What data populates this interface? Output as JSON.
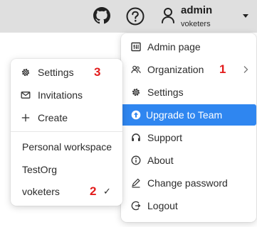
{
  "header": {
    "username": "admin",
    "login": "voketers",
    "icons": [
      "github-icon",
      "help-icon",
      "user-icon",
      "caret-down-icon"
    ]
  },
  "user_menu": {
    "items": [
      {
        "label": "Admin page",
        "icon": "admin-panel-icon"
      },
      {
        "label": "Organization",
        "icon": "organization-icon",
        "badge": "1"
      },
      {
        "label": "Settings",
        "icon": "gear-icon"
      },
      {
        "label": "Upgrade to Team",
        "icon": "upgrade-arrow-icon",
        "highlighted": true
      },
      {
        "label": "Support",
        "icon": "headset-icon"
      },
      {
        "label": "About",
        "icon": "info-icon"
      },
      {
        "label": "Change password",
        "icon": "pencil-icon"
      },
      {
        "label": "Logout",
        "icon": "logout-icon"
      }
    ],
    "highlight_color": "#2f86f0"
  },
  "organization_menu": {
    "items": [
      {
        "label": "Settings",
        "icon": "gear-icon",
        "badge": "3"
      },
      {
        "label": "Invitations",
        "icon": "envelope-icon"
      },
      {
        "label": "Create",
        "icon": "plus-icon"
      }
    ],
    "workspaces": [
      {
        "label": "Personal workspace"
      },
      {
        "label": "TestOrg"
      },
      {
        "label": "voketers",
        "badge": "2",
        "check": "✓"
      }
    ]
  },
  "annotation_color": "#e21b1b"
}
